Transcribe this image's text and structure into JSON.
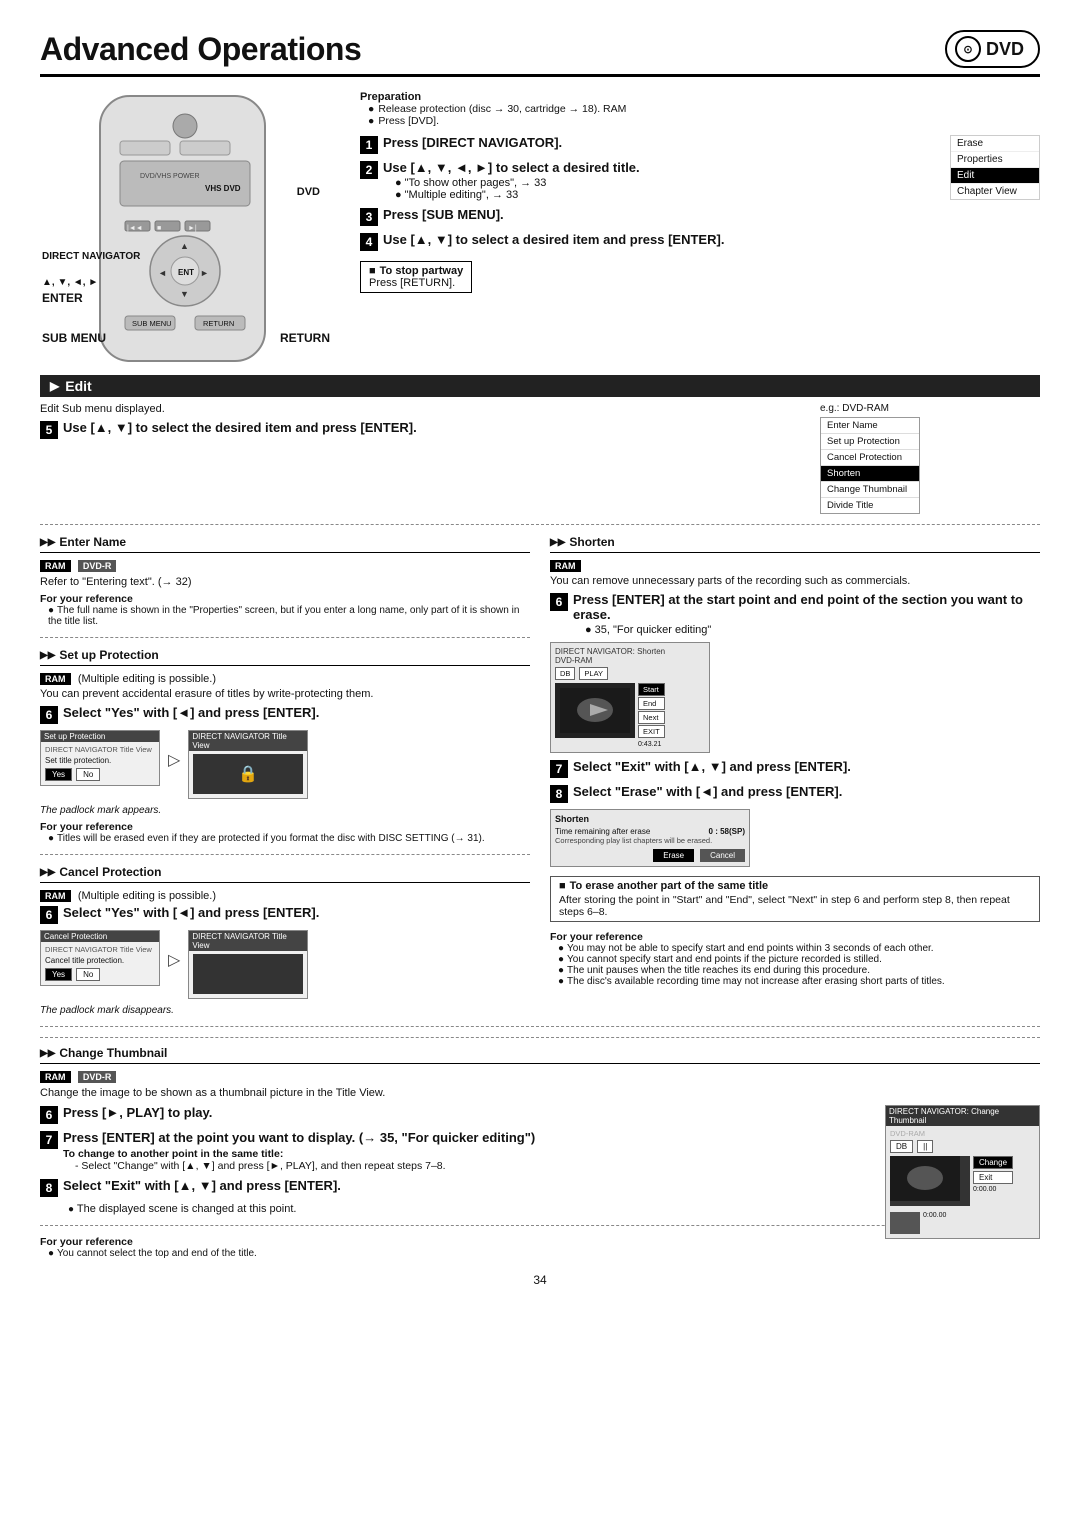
{
  "page": {
    "title": "Advanced Operations",
    "dvd_label": "DVD",
    "page_number": "34"
  },
  "dvd_badge": {
    "icon": "⊙",
    "label": "DVD"
  },
  "preparation": {
    "title": "Preparation",
    "items": [
      "Release protection (disc → 30, cartridge → 18). RAM",
      "Press [DVD]."
    ]
  },
  "main_steps": [
    {
      "num": "1",
      "text": "Press [DIRECT NAVIGATOR]."
    },
    {
      "num": "2",
      "text": "Use [▲, ▼, ◄, ►] to select a desired title.",
      "sub": [
        "\"To show other pages\", → 33",
        "\"Multiple editing\", → 33"
      ]
    },
    {
      "num": "3",
      "text": "Press [SUB MENU]."
    },
    {
      "num": "4",
      "text": "Use [▲, ▼] to select a desired item and press [ENTER]."
    }
  ],
  "stop_partway": {
    "title": "To stop partway",
    "text": "Press [RETURN]."
  },
  "side_menu": {
    "items": [
      "Erase",
      "Properties",
      "Edit",
      "Chapter View"
    ],
    "highlight": "Edit"
  },
  "edit_section": {
    "label": "Edit",
    "sub_label": "Edit Sub menu displayed.",
    "eg_label": "e.g.: DVD-RAM"
  },
  "edit_step5": {
    "num": "5",
    "text": "Use [▲, ▼] to select the desired item and press [ENTER]."
  },
  "edit_menu": {
    "items": [
      "Enter Name",
      "Set up Protection",
      "Cancel Protection",
      "Shorten",
      "Change Thumbnail",
      "Divide Title"
    ],
    "highlight": "Shorten"
  },
  "enter_name": {
    "title": "Enter Name",
    "badges": [
      "RAM",
      "DVD-R"
    ],
    "ref_text": "Refer to \"Entering text\". (→ 32)",
    "for_ref": {
      "title": "For your reference",
      "items": [
        "The full name is shown in the \"Properties\" screen, but if you enter a long name, only part of it is shown in the title list."
      ]
    }
  },
  "set_up_protection": {
    "title": "Set up Protection",
    "badges": [
      "RAM"
    ],
    "sub_text": "(Multiple editing is possible.)",
    "desc": "You can prevent accidental erasure of titles by write-protecting them.",
    "step6": {
      "num": "6",
      "text": "Select \"Yes\" with [◄] and press [ENTER]."
    },
    "screen1": {
      "title": "Set up Protection",
      "subtitle": "DIRECT NAVIGATOR Title View",
      "label": "Set title protection.",
      "buttons": [
        "Yes",
        "No"
      ]
    },
    "padlock_note": "The padlock mark appears.",
    "for_ref": {
      "title": "For your reference",
      "items": [
        "Titles will be erased even if they are protected if you format the disc with DISC SETTING (→ 31)."
      ]
    }
  },
  "cancel_protection": {
    "title": "Cancel Protection",
    "badges": [
      "RAM"
    ],
    "sub_text": "(Multiple editing is possible.)",
    "step6": {
      "num": "6",
      "text": "Select \"Yes\" with [◄] and press [ENTER]."
    },
    "screen1": {
      "title": "Cancel Protection",
      "subtitle": "DIRECT NAVIGATOR Title View",
      "label": "Cancel title protection.",
      "buttons": [
        "Yes",
        "No"
      ]
    },
    "padlock_note": "The padlock mark disappears."
  },
  "shorten": {
    "title": "Shorten",
    "badges": [
      "RAM"
    ],
    "desc": "You can remove unnecessary parts of the recording such as commercials.",
    "step6": {
      "num": "6",
      "text": "Press [ENTER] at the start point and end point of the section you want to erase.",
      "sub": [
        "35, \"For quicker editing\""
      ]
    },
    "step7": {
      "num": "7",
      "text": "Select \"Exit\" with [▲, ▼] and press [ENTER]."
    },
    "step8": {
      "num": "8",
      "text": "Select \"Erase\" with [◄] and press [ENTER]."
    },
    "shorten_screen": {
      "title": "DIRECT NAVIGATOR: Shorten",
      "subtitle": "DVD-RAM",
      "buttons": [
        "DB",
        "PLAY"
      ],
      "menu_items": [
        "Start",
        "End",
        "Next",
        "EXIT"
      ],
      "timecode": "0:43.21"
    },
    "erase_bar": {
      "label": "Shorten",
      "time_label": "Time remaining after erase",
      "time_value": "0 : 58(SP)",
      "note": "Corresponding play list chapters will be erased.",
      "buttons": [
        "Erase",
        "Cancel"
      ]
    },
    "to_erase_another": {
      "title": "To erase another part of the same title",
      "text": "After storing the point in \"Start\" and \"End\", select \"Next\" in step 6 and perform step 8, then repeat steps 6–8."
    },
    "for_ref": {
      "title": "For your reference",
      "items": [
        "You may not be able to specify start and end points within 3 seconds of each other.",
        "You cannot specify start and end points if the picture recorded is stilled.",
        "The unit pauses when the title reaches its end during this procedure.",
        "The disc's available recording time may not increase after erasing short parts of titles."
      ]
    }
  },
  "change_thumbnail": {
    "title": "Change Thumbnail",
    "badges": [
      "RAM",
      "DVD-R"
    ],
    "desc": "Change the image to be shown as a thumbnail picture in the Title View.",
    "step6": {
      "num": "6",
      "text": "Press [►, PLAY] to play."
    },
    "step7": {
      "num": "7",
      "text": "Press [ENTER] at the point you want to display. (→ 35, \"For quicker editing\")",
      "sub_title": "To change to another point in the same title:",
      "sub_items": [
        "- Select \"Change\" with [▲, ▼] and press [►, PLAY], and then repeat steps 7–8."
      ]
    },
    "step8": {
      "num": "8",
      "text": "Select \"Exit\" with [▲, ▼] and press [ENTER]."
    },
    "note": "The displayed scene is changed at this point.",
    "thumb_screen": {
      "title": "DIRECT NAVIGATOR: Change Thumbnail",
      "subtitle": "DVD-RAM",
      "buttons": [
        "DB",
        "||"
      ],
      "menu_items": [
        "Change",
        "Exit"
      ],
      "timecodes": [
        "0:00.00",
        "0:00.00"
      ]
    },
    "for_ref": {
      "title": "For your reference",
      "items": [
        "You cannot select the top and end of the title."
      ]
    }
  },
  "remote": {
    "labels": {
      "dvd": "DVD",
      "direct_navigator": "DIRECT NAVIGATOR",
      "arrows": "▲, ▼, ◄, ►",
      "enter": "ENTER",
      "sub_menu": "SUB MENU",
      "return": "RETURN"
    }
  }
}
